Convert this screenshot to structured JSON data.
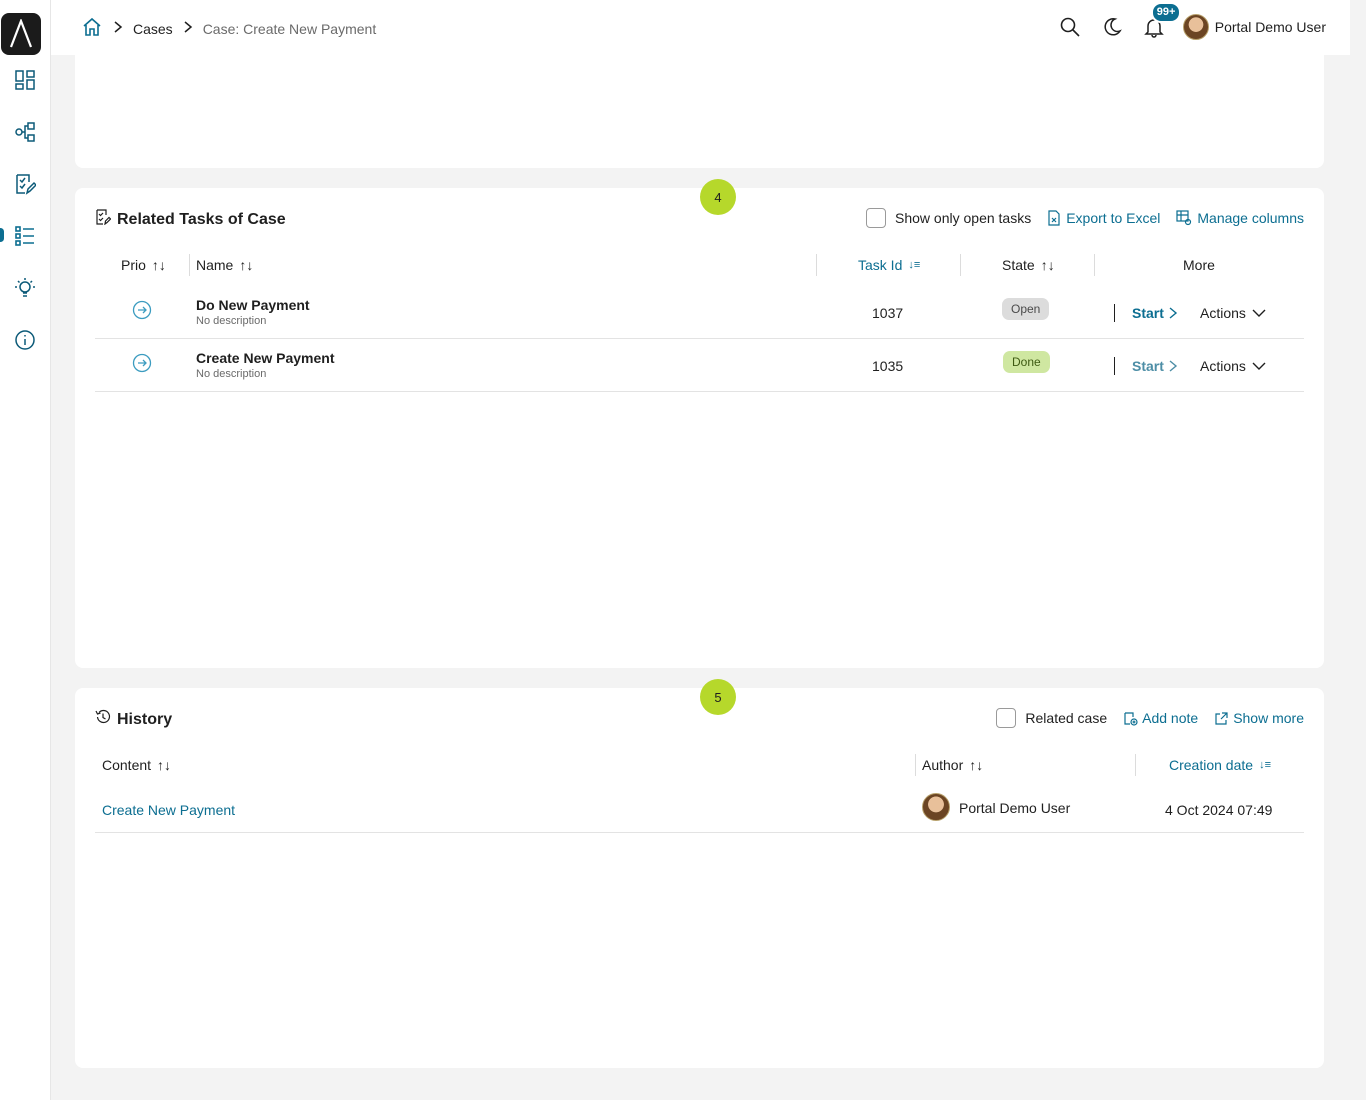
{
  "breadcrumb": {
    "items": [
      "Cases",
      "Case: Create New Payment"
    ]
  },
  "header": {
    "notification_badge": "99+",
    "user_name": "Portal Demo User"
  },
  "sidebar": {
    "items": [
      "dashboard-icon",
      "process-icon",
      "task-icon",
      "case-list-icon",
      "idea-icon",
      "info-icon"
    ],
    "active": "case-list-icon"
  },
  "tasks_card": {
    "step": "4",
    "title": "Related Tasks of Case",
    "show_open_label": "Show only open tasks",
    "export_label": "Export to Excel",
    "manage_label": "Manage columns",
    "columns": {
      "prio": "Prio",
      "name": "Name",
      "task_id": "Task Id",
      "state": "State",
      "more": "More"
    },
    "rows": [
      {
        "name": "Do New Payment",
        "description": "No description",
        "id": "1037",
        "state": "Open",
        "start": "Start",
        "actions": "Actions"
      },
      {
        "name": "Create New Payment",
        "description": "No description",
        "id": "1035",
        "state": "Done",
        "start": "Start",
        "actions": "Actions"
      }
    ]
  },
  "history_card": {
    "step": "5",
    "title": "History",
    "related_case_label": "Related case",
    "add_note_label": "Add note",
    "show_more_label": "Show more",
    "columns": {
      "content": "Content",
      "author": "Author",
      "creation_date": "Creation date"
    },
    "rows": [
      {
        "content": "Create New Payment",
        "author": "Portal Demo User",
        "date": "4 Oct 2024 07:49"
      }
    ]
  },
  "colors": {
    "accent": "#0c6e91",
    "step_badge": "#b6d82b",
    "done_state": "#cfe7a1",
    "open_state": "#dcdcdc"
  }
}
